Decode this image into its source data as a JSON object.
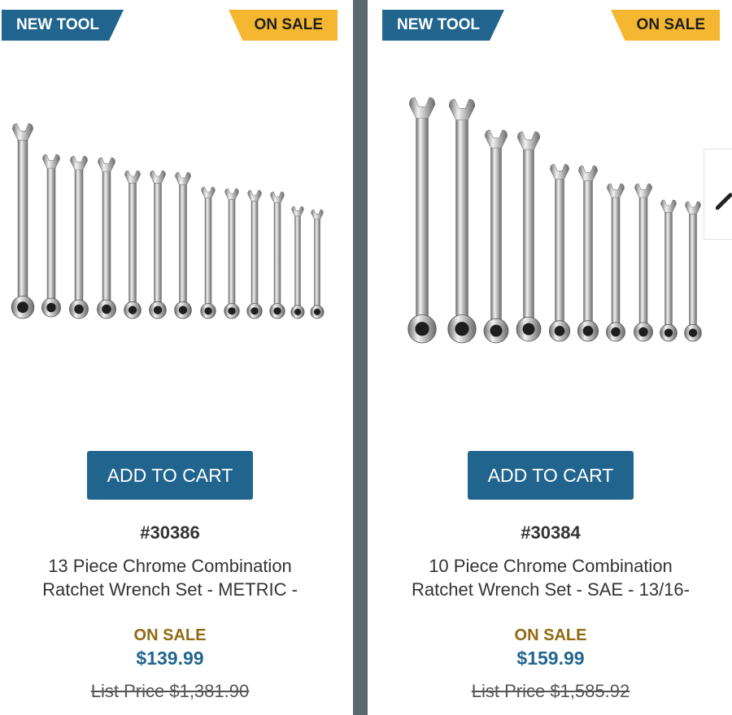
{
  "products": [
    {
      "badge_new": "NEW TOOL",
      "badge_sale": "ON SALE",
      "image_icon": "ratchet-wrench-set-13pc",
      "add_to_cart": "ADD TO CART",
      "sku": "#30386",
      "title_line1": "13 Piece Chrome Combination",
      "title_line2": "Ratchet Wrench Set - METRIC -",
      "sale_label": "ON SALE",
      "price": "$139.99",
      "list_price": "List Price $1,381.90"
    },
    {
      "badge_new": "NEW TOOL",
      "badge_sale": "ON SALE",
      "image_icon": "ratchet-wrench-set-10pc",
      "add_to_cart": "ADD TO CART",
      "sku": "#30384",
      "title_line1": "10 Piece Chrome Combination",
      "title_line2": "Ratchet Wrench Set - SAE - 13/16-",
      "sale_label": "ON SALE",
      "price": "$159.99",
      "list_price": "List Price $1,585.92"
    }
  ],
  "carousel": {
    "next_icon": "chevron-right-icon"
  },
  "colors": {
    "brand_blue": "#21658f",
    "badge_yellow": "#f5b731",
    "sale_gold": "#8f6a13",
    "divider": "#5a6970"
  }
}
